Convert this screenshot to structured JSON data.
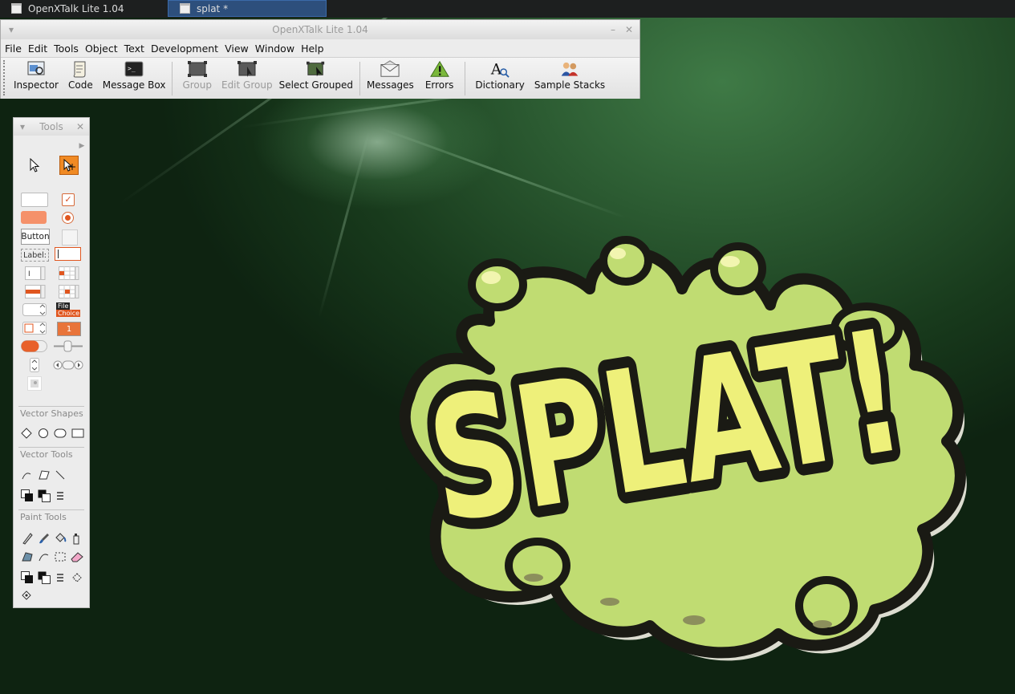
{
  "taskbar": {
    "tasks": [
      {
        "label": "OpenXTalk Lite 1.04"
      },
      {
        "label": "splat *"
      }
    ]
  },
  "window": {
    "title": "OpenXTalk Lite 1.04",
    "menus": [
      "File",
      "Edit",
      "Tools",
      "Object",
      "Text",
      "Development",
      "View",
      "Window",
      "Help"
    ],
    "toolbar": [
      {
        "label": "Inspector",
        "icon": "inspector-icon"
      },
      {
        "label": "Code",
        "icon": "script-icon"
      },
      {
        "label": "Message Box",
        "icon": "terminal-icon"
      },
      {
        "label": "Group",
        "icon": "group-icon",
        "disabled": true
      },
      {
        "label": "Edit Group",
        "icon": "edit-group-icon",
        "disabled": true
      },
      {
        "label": "Select Grouped",
        "icon": "select-grouped-icon"
      },
      {
        "label": "Messages",
        "icon": "envelope-icon"
      },
      {
        "label": "Errors",
        "icon": "warning-icon"
      },
      {
        "label": "Dictionary",
        "icon": "dictionary-icon"
      },
      {
        "label": "Sample Stacks",
        "icon": "users-icon"
      }
    ]
  },
  "palette": {
    "title": "Tools",
    "controls": {
      "button_label": "Button",
      "label_label": "Label:",
      "file_label": "File",
      "choice_label": "Choice",
      "number_label": "1"
    },
    "sections": {
      "vector_shapes": "Vector Shapes",
      "vector_tools": "Vector Tools",
      "paint_tools": "Paint Tools"
    }
  },
  "canvas": {
    "image_text": "SPLAT!",
    "colors": {
      "splat": "#c0dc72",
      "letters": "#eef07a",
      "outline": "#1a1a14"
    }
  }
}
